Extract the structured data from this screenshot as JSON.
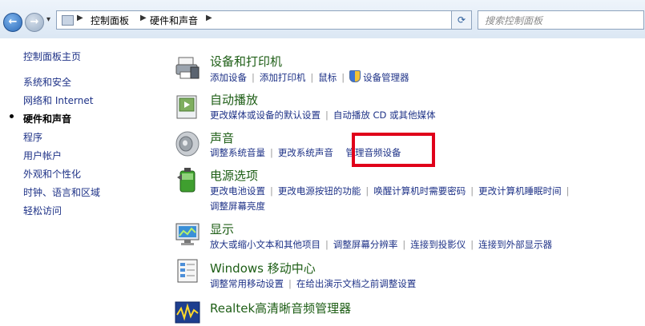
{
  "address": {
    "breadcrumbs": [
      "控制面板",
      "硬件和声音"
    ],
    "search_placeholder": "搜索控制面板"
  },
  "sidebar": {
    "items": [
      {
        "label": "控制面板主页"
      },
      {
        "label": "系统和安全"
      },
      {
        "label": "网络和 Internet"
      },
      {
        "label": "硬件和声音",
        "current": true
      },
      {
        "label": "程序"
      },
      {
        "label": "用户帐户"
      },
      {
        "label": "外观和个性化"
      },
      {
        "label": "时钟、语言和区域"
      },
      {
        "label": "轻松访问"
      }
    ]
  },
  "categories": [
    {
      "title": "设备和打印机",
      "icon": "printer-icon",
      "links": [
        "添加设备",
        "添加打印机",
        "鼠标",
        "设备管理器"
      ]
    },
    {
      "title": "自动播放",
      "icon": "autoplay-icon",
      "links": [
        "更改媒体或设备的默认设置",
        "自动播放 CD 或其他媒体"
      ]
    },
    {
      "title": "声音",
      "icon": "speaker-icon",
      "links": [
        "调整系统音量",
        "更改系统声音",
        "管理音频设备"
      ]
    },
    {
      "title": "电源选项",
      "icon": "battery-icon",
      "links": [
        "更改电池设置",
        "更改电源按钮的功能",
        "唤醒计算机时需要密码",
        "更改计算机睡眠时间",
        "调整屏幕亮度"
      ]
    },
    {
      "title": "显示",
      "icon": "display-icon",
      "links": [
        "放大或缩小文本和其他项目",
        "调整屏幕分辨率",
        "连接到投影仪",
        "连接到外部显示器"
      ]
    },
    {
      "title": "Windows 移动中心",
      "icon": "mobility-center-icon",
      "links": [
        "调整常用移动设置",
        "在给出演示文档之前调整设置"
      ]
    },
    {
      "title": "Realtek高清晰音频管理器",
      "icon": "realtek-audio-icon",
      "links": []
    }
  ],
  "colors": {
    "highlight": "#e0001a",
    "link": "#1e3287",
    "title": "#1e5e16"
  }
}
